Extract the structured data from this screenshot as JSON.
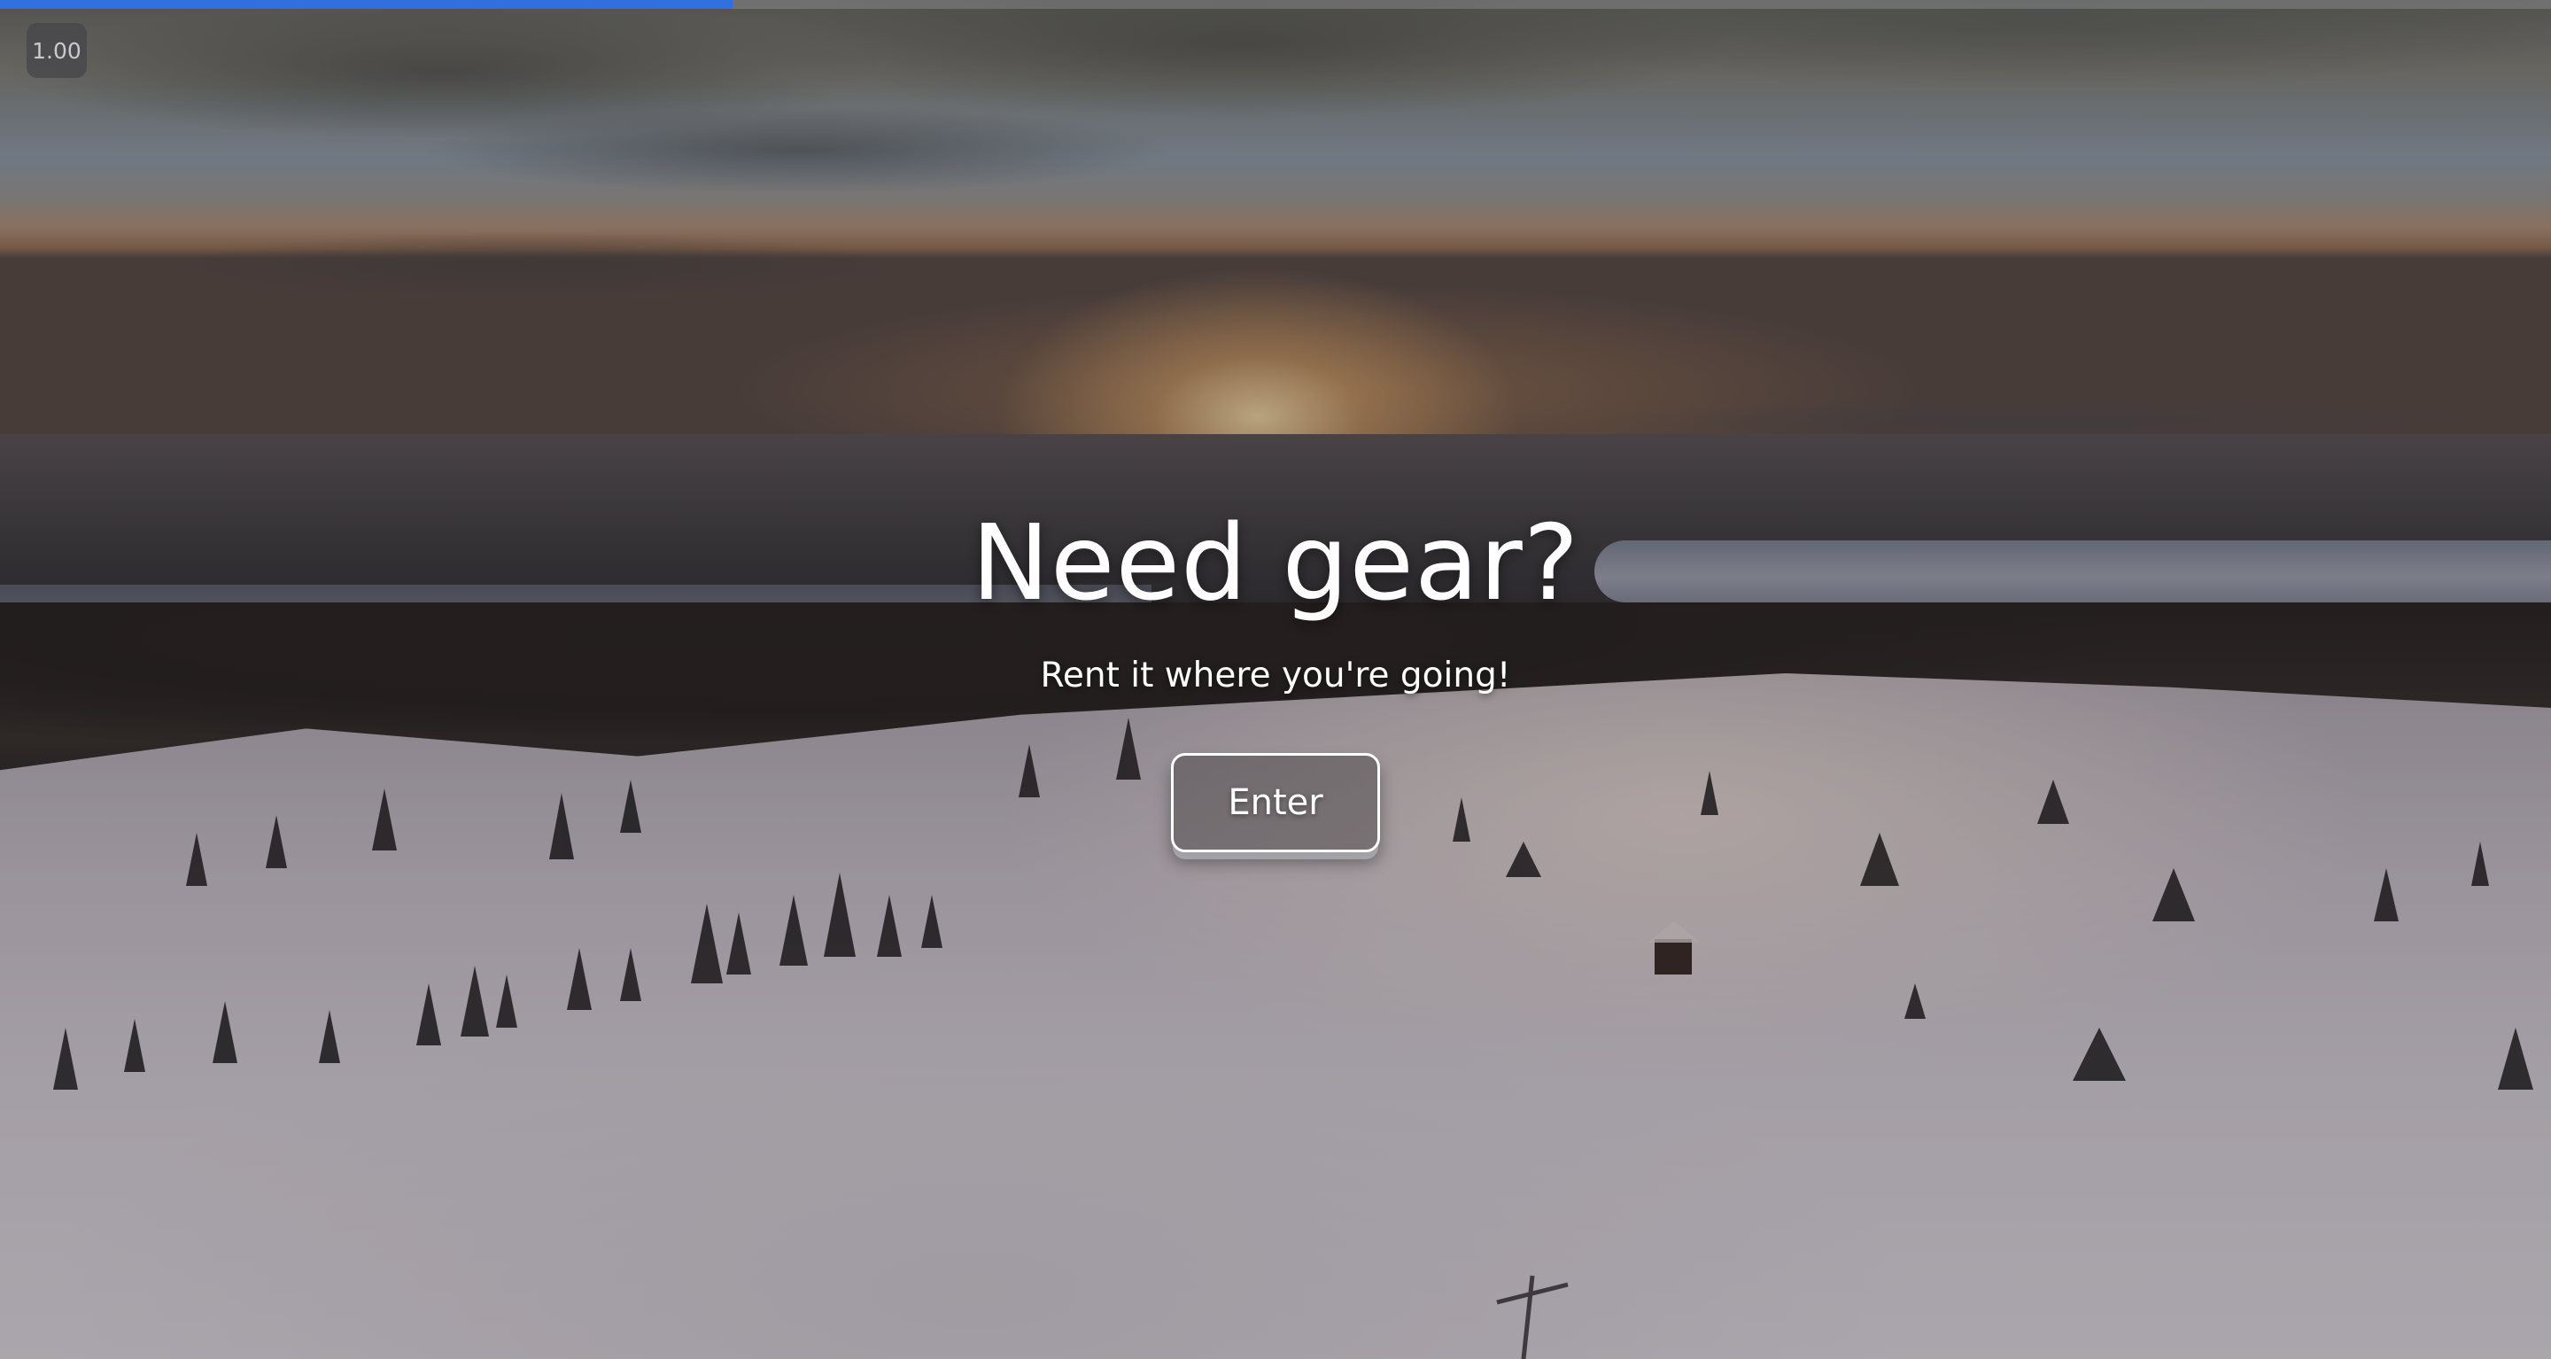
{
  "viewer": {
    "zoom_label": "1.00",
    "progress_percent": 28.7,
    "progress_color": "#2f6fe0"
  },
  "hero": {
    "title": "Need gear?",
    "subtitle": "Rent it where you're going!",
    "enter_label": "Enter"
  },
  "background": {
    "description_icon": "snowy-mountain-sunset-photo"
  }
}
